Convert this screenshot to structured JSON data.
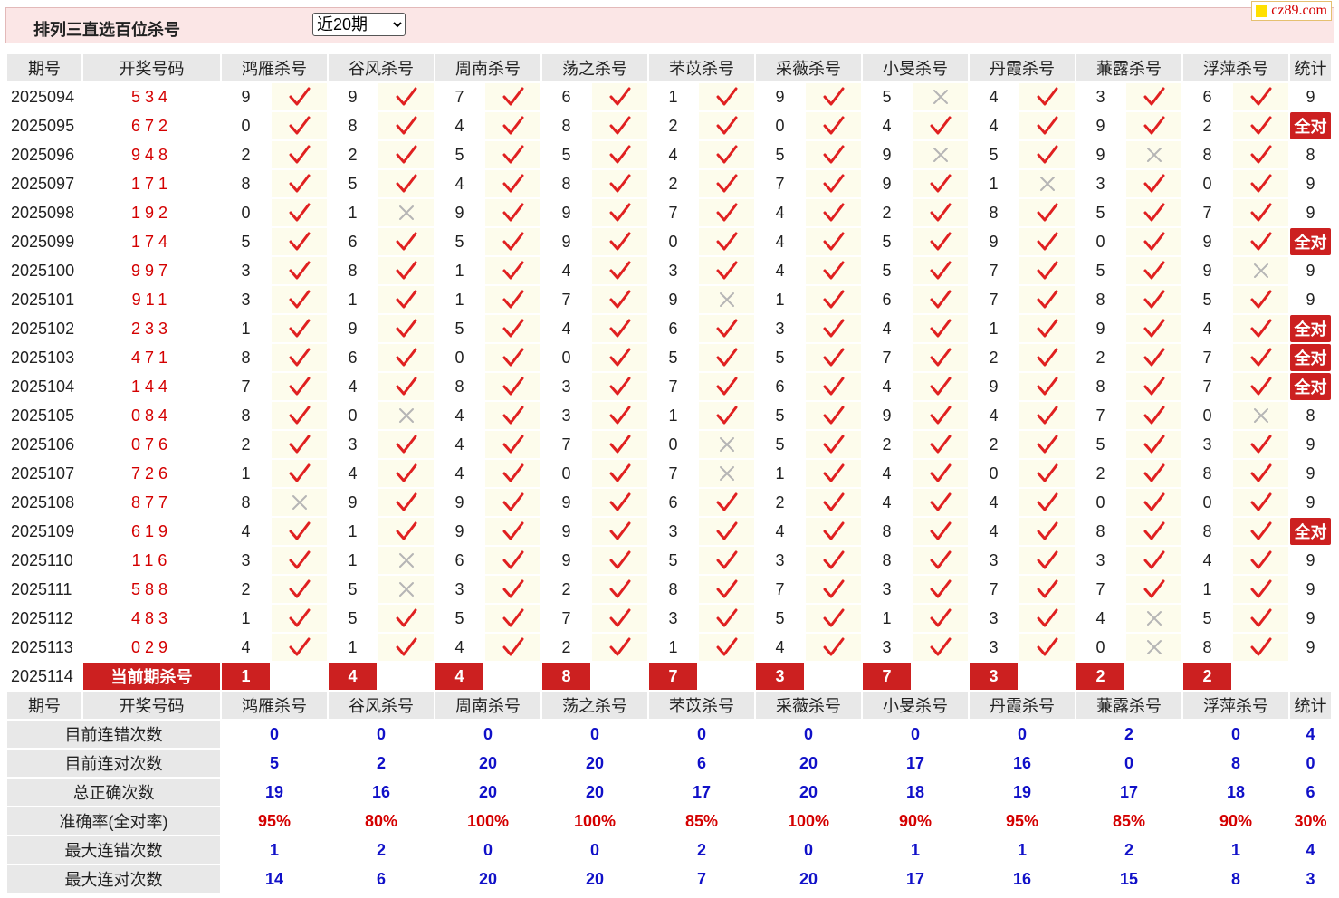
{
  "header": {
    "title": "排列三直选百位杀号",
    "period_select": {
      "selected": "近20期"
    },
    "site_logo": "cz89.com"
  },
  "table": {
    "columns": {
      "period": "期号",
      "draw": "开奖号码",
      "stat": "统计"
    },
    "experts": [
      "鸿雁杀号",
      "谷风杀号",
      "周南杀号",
      "荡之杀号",
      "芣苡杀号",
      "采薇杀号",
      "小旻杀号",
      "丹霞杀号",
      "蒹露杀号",
      "浮萍杀号"
    ],
    "rows": [
      {
        "period": "2025094",
        "draw": "534",
        "kills": [
          9,
          9,
          7,
          6,
          1,
          9,
          5,
          4,
          3,
          6
        ],
        "hits": [
          1,
          1,
          1,
          1,
          1,
          1,
          0,
          1,
          1,
          1
        ],
        "stat": "9"
      },
      {
        "period": "2025095",
        "draw": "672",
        "kills": [
          0,
          8,
          4,
          8,
          2,
          0,
          4,
          4,
          9,
          2
        ],
        "hits": [
          1,
          1,
          1,
          1,
          1,
          1,
          1,
          1,
          1,
          1
        ],
        "stat": "全对"
      },
      {
        "period": "2025096",
        "draw": "948",
        "kills": [
          2,
          2,
          5,
          5,
          4,
          5,
          9,
          5,
          9,
          8
        ],
        "hits": [
          1,
          1,
          1,
          1,
          1,
          1,
          0,
          1,
          0,
          1
        ],
        "stat": "8"
      },
      {
        "period": "2025097",
        "draw": "171",
        "kills": [
          8,
          5,
          4,
          8,
          2,
          7,
          9,
          1,
          3,
          0
        ],
        "hits": [
          1,
          1,
          1,
          1,
          1,
          1,
          1,
          0,
          1,
          1
        ],
        "stat": "9"
      },
      {
        "period": "2025098",
        "draw": "192",
        "kills": [
          0,
          1,
          9,
          9,
          7,
          4,
          2,
          8,
          5,
          7
        ],
        "hits": [
          1,
          0,
          1,
          1,
          1,
          1,
          1,
          1,
          1,
          1
        ],
        "stat": "9"
      },
      {
        "period": "2025099",
        "draw": "174",
        "kills": [
          5,
          6,
          5,
          9,
          0,
          4,
          5,
          9,
          0,
          9
        ],
        "hits": [
          1,
          1,
          1,
          1,
          1,
          1,
          1,
          1,
          1,
          1
        ],
        "stat": "全对"
      },
      {
        "period": "2025100",
        "draw": "997",
        "kills": [
          3,
          8,
          1,
          4,
          3,
          4,
          5,
          7,
          5,
          9
        ],
        "hits": [
          1,
          1,
          1,
          1,
          1,
          1,
          1,
          1,
          1,
          0
        ],
        "stat": "9"
      },
      {
        "period": "2025101",
        "draw": "911",
        "kills": [
          3,
          1,
          1,
          7,
          9,
          1,
          6,
          7,
          8,
          5
        ],
        "hits": [
          1,
          1,
          1,
          1,
          0,
          1,
          1,
          1,
          1,
          1
        ],
        "stat": "9"
      },
      {
        "period": "2025102",
        "draw": "233",
        "kills": [
          1,
          9,
          5,
          4,
          6,
          3,
          4,
          1,
          9,
          4
        ],
        "hits": [
          1,
          1,
          1,
          1,
          1,
          1,
          1,
          1,
          1,
          1
        ],
        "stat": "全对"
      },
      {
        "period": "2025103",
        "draw": "471",
        "kills": [
          8,
          6,
          0,
          0,
          5,
          5,
          7,
          2,
          2,
          7
        ],
        "hits": [
          1,
          1,
          1,
          1,
          1,
          1,
          1,
          1,
          1,
          1
        ],
        "stat": "全对"
      },
      {
        "period": "2025104",
        "draw": "144",
        "kills": [
          7,
          4,
          8,
          3,
          7,
          6,
          4,
          9,
          8,
          7
        ],
        "hits": [
          1,
          1,
          1,
          1,
          1,
          1,
          1,
          1,
          1,
          1
        ],
        "stat": "全对"
      },
      {
        "period": "2025105",
        "draw": "084",
        "kills": [
          8,
          0,
          4,
          3,
          1,
          5,
          9,
          4,
          7,
          0
        ],
        "hits": [
          1,
          0,
          1,
          1,
          1,
          1,
          1,
          1,
          1,
          0
        ],
        "stat": "8"
      },
      {
        "period": "2025106",
        "draw": "076",
        "kills": [
          2,
          3,
          4,
          7,
          0,
          5,
          2,
          2,
          5,
          3
        ],
        "hits": [
          1,
          1,
          1,
          1,
          0,
          1,
          1,
          1,
          1,
          1
        ],
        "stat": "9"
      },
      {
        "period": "2025107",
        "draw": "726",
        "kills": [
          1,
          4,
          4,
          0,
          7,
          1,
          4,
          0,
          2,
          8
        ],
        "hits": [
          1,
          1,
          1,
          1,
          0,
          1,
          1,
          1,
          1,
          1
        ],
        "stat": "9"
      },
      {
        "period": "2025108",
        "draw": "877",
        "kills": [
          8,
          9,
          9,
          9,
          6,
          2,
          4,
          4,
          0,
          0
        ],
        "hits": [
          0,
          1,
          1,
          1,
          1,
          1,
          1,
          1,
          1,
          1
        ],
        "stat": "9"
      },
      {
        "period": "2025109",
        "draw": "619",
        "kills": [
          4,
          1,
          9,
          9,
          3,
          4,
          8,
          4,
          8,
          8
        ],
        "hits": [
          1,
          1,
          1,
          1,
          1,
          1,
          1,
          1,
          1,
          1
        ],
        "stat": "全对"
      },
      {
        "period": "2025110",
        "draw": "116",
        "kills": [
          3,
          1,
          6,
          9,
          5,
          3,
          8,
          3,
          3,
          4
        ],
        "hits": [
          1,
          0,
          1,
          1,
          1,
          1,
          1,
          1,
          1,
          1
        ],
        "stat": "9"
      },
      {
        "period": "2025111",
        "draw": "588",
        "kills": [
          2,
          5,
          3,
          2,
          8,
          7,
          3,
          7,
          7,
          1
        ],
        "hits": [
          1,
          0,
          1,
          1,
          1,
          1,
          1,
          1,
          1,
          1
        ],
        "stat": "9"
      },
      {
        "period": "2025112",
        "draw": "483",
        "kills": [
          1,
          5,
          5,
          7,
          3,
          5,
          1,
          3,
          4,
          5
        ],
        "hits": [
          1,
          1,
          1,
          1,
          1,
          1,
          1,
          1,
          0,
          1
        ],
        "stat": "9"
      },
      {
        "period": "2025113",
        "draw": "029",
        "kills": [
          4,
          1,
          4,
          2,
          1,
          4,
          3,
          3,
          0,
          8
        ],
        "hits": [
          1,
          1,
          1,
          1,
          1,
          1,
          1,
          1,
          0,
          1
        ],
        "stat": "9"
      }
    ],
    "current": {
      "period": "2025114",
      "label": "当前期杀号",
      "kills": [
        1,
        4,
        4,
        8,
        7,
        3,
        7,
        3,
        2,
        2
      ]
    },
    "summary_header": {
      "period": "期号",
      "draw": "开奖号码",
      "stat": "统计"
    },
    "summary": [
      {
        "label": "目前连错次数",
        "values": [
          "0",
          "0",
          "0",
          "0",
          "0",
          "0",
          "0",
          "0",
          "2",
          "0"
        ],
        "stat": "4"
      },
      {
        "label": "目前连对次数",
        "values": [
          "5",
          "2",
          "20",
          "20",
          "6",
          "20",
          "17",
          "16",
          "0",
          "8"
        ],
        "stat": "0"
      },
      {
        "label": "总正确次数",
        "values": [
          "19",
          "16",
          "20",
          "20",
          "17",
          "20",
          "18",
          "19",
          "17",
          "18"
        ],
        "stat": "6"
      },
      {
        "label": "准确率(全对率)",
        "values": [
          "95%",
          "80%",
          "100%",
          "100%",
          "85%",
          "100%",
          "90%",
          "95%",
          "85%",
          "90%"
        ],
        "stat": "30%",
        "is_percent": true
      },
      {
        "label": "最大连错次数",
        "values": [
          "1",
          "2",
          "0",
          "0",
          "2",
          "0",
          "1",
          "1",
          "2",
          "1"
        ],
        "stat": "4"
      },
      {
        "label": "最大连对次数",
        "values": [
          "14",
          "6",
          "20",
          "20",
          "7",
          "20",
          "17",
          "16",
          "15",
          "8"
        ],
        "stat": "3"
      }
    ]
  },
  "icons": {
    "hit": "check-icon",
    "miss": "cross-icon"
  },
  "colors": {
    "accent_red": "#cc2020",
    "check_red": "#e02020",
    "cross_gray": "#b5b5b5",
    "value_blue": "#1010c8",
    "header_bg": "#e8e8e8",
    "mark_bg": "#fdfcec"
  }
}
